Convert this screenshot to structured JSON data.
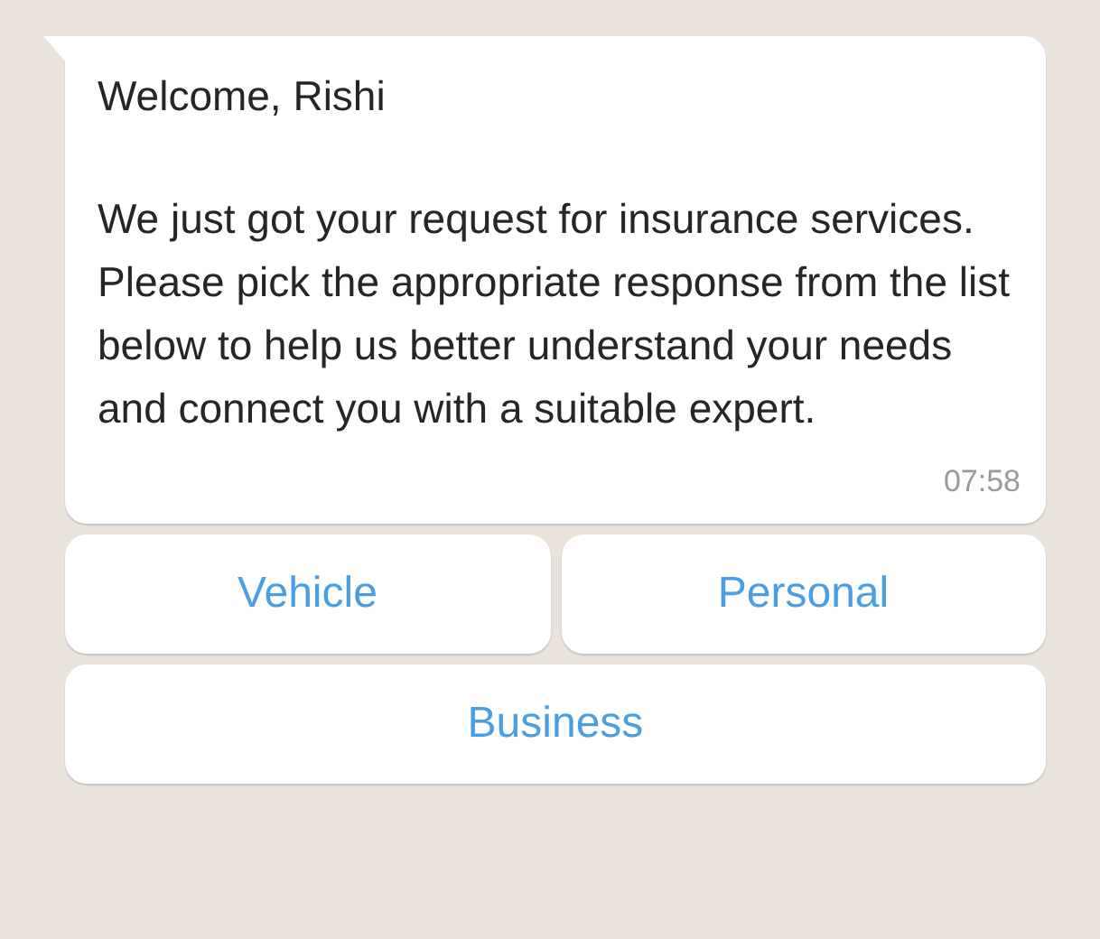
{
  "message": {
    "greeting": "Welcome, Rishi",
    "body": "We just got your request for insurance services. Please pick the appropriate response from the list below to help us better understand your needs and connect you with a suitable expert.",
    "time": "07:58"
  },
  "reply_buttons": [
    {
      "label": "Vehicle"
    },
    {
      "label": "Personal"
    },
    {
      "label": "Business"
    }
  ]
}
